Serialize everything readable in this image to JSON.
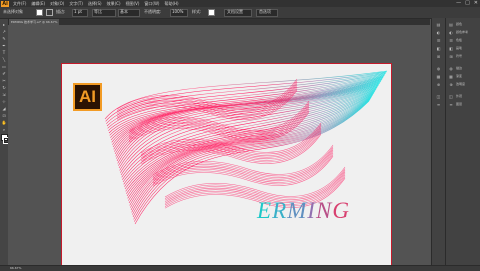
{
  "menubar": {
    "logo": "Ai",
    "items": [
      "文件(F)",
      "编辑(E)",
      "对象(O)",
      "文字(T)",
      "选择(S)",
      "效果(C)",
      "视图(V)",
      "窗口(W)",
      "帮助(H)"
    ],
    "window_controls": [
      "—",
      "□",
      "✕"
    ]
  },
  "control_bar": {
    "mode": "未选择对象",
    "stroke_label": "描边:",
    "stroke_value": "1 pt",
    "uniform": "等比",
    "basic": "基本",
    "opacity_label": "不透明度:",
    "opacity_value": "100%",
    "style_label": "样式:",
    "doc_setup": "文档设置",
    "prefs": "首选项"
  },
  "document_tab": {
    "label": "ERMING 技术学习.ai* @ 66.67% (RGB/GPU 预览)"
  },
  "tools": [
    "▸",
    "↗",
    "✎",
    "✒",
    "T",
    "╲",
    "▭",
    "✐",
    "✂",
    "↻",
    "⇲",
    "⊹",
    "◢",
    "⊡",
    "✋",
    "⌕"
  ],
  "right_panel_icons": [
    "▤",
    "◐",
    "☰",
    "◧",
    "⊞",
    "◍",
    "▦",
    "⊕",
    "◫",
    "≡"
  ],
  "right_panel_labels": [
    "颜色",
    "颜色参考",
    "色板",
    "画笔",
    "符号",
    "描边",
    "渐变",
    "透明度",
    "外观",
    "图层"
  ],
  "status": {
    "zoom": "66.67%"
  },
  "artboard": {
    "badge_text": "AI",
    "title_text": "ERMING"
  },
  "colors": {
    "badge_border": "#f29b25",
    "badge_bg": "#2b1303",
    "shape_pink": "#ff1e63",
    "shape_cyan": "#24e0e0",
    "artboard_border": "#c41a2b"
  }
}
